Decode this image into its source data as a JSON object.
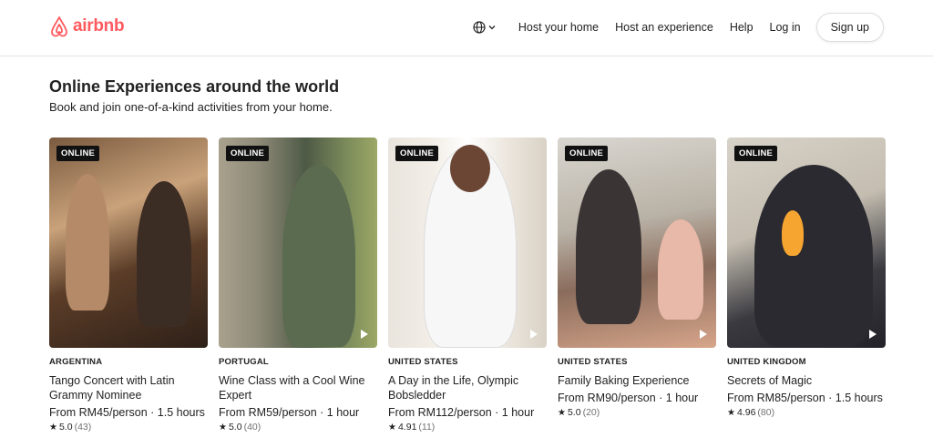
{
  "brand": {
    "name": "airbnb",
    "color": "#ff5a5f"
  },
  "nav": {
    "items": [
      "Host your home",
      "Host an experience",
      "Help",
      "Log in"
    ],
    "signup": "Sign up",
    "language_icon": "globe-icon"
  },
  "section": {
    "title": "Online Experiences around the world",
    "subtitle": "Book and join one-of-a-kind activities from your home."
  },
  "cards": [
    {
      "badge": "ONLINE",
      "country": "ARGENTINA",
      "name": "Tango Concert with Latin Grammy Nominee",
      "price": "From RM45/person · 1.5 hours",
      "rating": "5.0",
      "reviews": "(43)"
    },
    {
      "badge": "ONLINE",
      "country": "PORTUGAL",
      "name": "Wine Class with a Cool Wine Expert",
      "price": "From RM59/person · 1 hour",
      "rating": "5.0",
      "reviews": "(40)"
    },
    {
      "badge": "ONLINE",
      "country": "UNITED STATES",
      "name": "A Day in the Life, Olympic Bobsledder",
      "price": "From RM112/person · 1 hour",
      "rating": "4.91",
      "reviews": "(11)"
    },
    {
      "badge": "ONLINE",
      "country": "UNITED STATES",
      "name": "Family Baking Experience",
      "price": "From RM90/person · 1 hour",
      "rating": "5.0",
      "reviews": "(20)"
    },
    {
      "badge": "ONLINE",
      "country": "UNITED KINGDOM",
      "name": "Secrets of Magic",
      "price": "From RM85/person · 1.5 hours",
      "rating": "4.96",
      "reviews": "(80)"
    }
  ]
}
